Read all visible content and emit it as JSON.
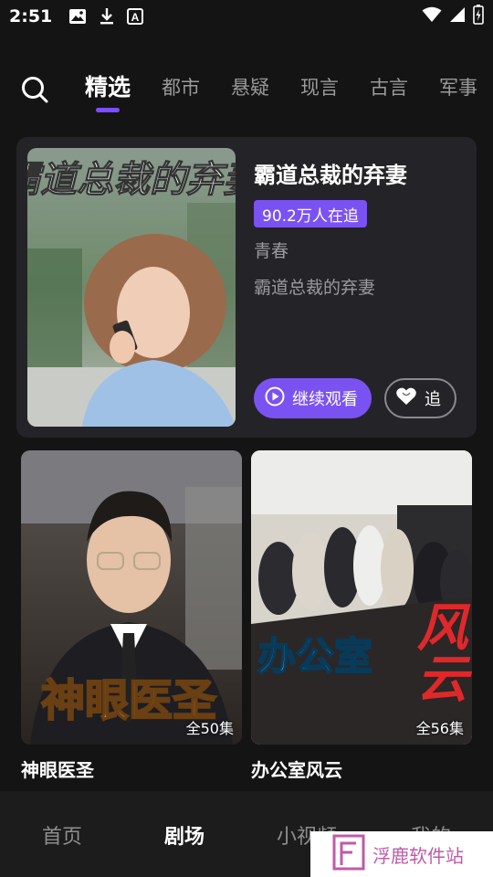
{
  "status_bar": {
    "time": "2:51",
    "icons": [
      "image-icon",
      "download-icon",
      "font-icon"
    ],
    "right_icons": [
      "wifi-icon",
      "signal-icon",
      "battery-icon"
    ]
  },
  "tabs": [
    {
      "label": "精选",
      "active": true
    },
    {
      "label": "都市"
    },
    {
      "label": "悬疑"
    },
    {
      "label": "现言"
    },
    {
      "label": "古言"
    },
    {
      "label": "军事"
    }
  ],
  "featured": {
    "cover_text": "霸道总裁的弃妻",
    "title": "霸道总裁的弃妻",
    "viewers": "90.2万人在追",
    "genre": "青春",
    "description": "霸道总裁的弃妻",
    "continue_label": "继续观看",
    "follow_label": "追"
  },
  "grid": [
    {
      "title": "神眼医圣",
      "episodes": "全50集",
      "cover_text": "神眼医圣"
    },
    {
      "title": "办公室风云",
      "episodes": "全56集",
      "cover_text": "办公室",
      "cover_text_2": "风云"
    }
  ],
  "bottom_nav": [
    {
      "label": "首页"
    },
    {
      "label": "剧场",
      "active": true
    },
    {
      "label": "小视频"
    },
    {
      "label": "我的"
    }
  ],
  "watermark": {
    "text": "浮鹿软件站"
  },
  "colors": {
    "accent": "#7b52f2",
    "background": "#141414",
    "card": "#242428"
  }
}
